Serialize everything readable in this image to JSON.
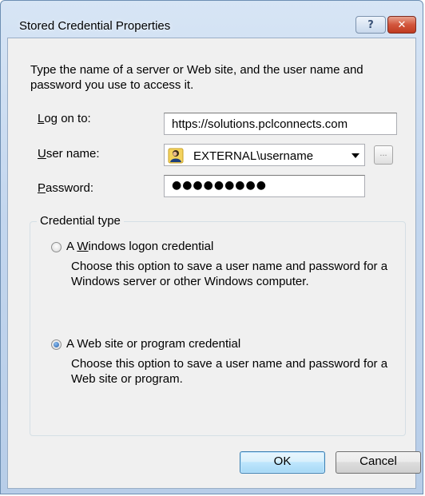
{
  "window": {
    "title": "Stored Credential Properties",
    "help_label": "?",
    "close_label": "✕"
  },
  "intro": "Type the name of a server or Web site, and the user name and password you use to access it.",
  "logon": {
    "label_prefix": "",
    "label_accel": "L",
    "label_rest": "og on to:",
    "value": "https://solutions.pclconnects.com"
  },
  "user": {
    "label_accel": "U",
    "label_rest": "ser name:",
    "value": "EXTERNAL\\username",
    "icon": "user-icon",
    "browse_label": "..."
  },
  "password": {
    "label_accel": "P",
    "label_rest": "assword:",
    "value": "●●●●●●●●●"
  },
  "credential_type": {
    "legend": "Credential type",
    "options": [
      {
        "label_prefix": "A ",
        "label_accel": "W",
        "label_rest": "indows logon credential",
        "description": "Choose this option to save a user name and password for a Windows server or other Windows computer.",
        "selected": false
      },
      {
        "label": "A Web site or program credential",
        "description": "Choose this option to save a user name and password for a Web site or program.",
        "selected": true
      }
    ]
  },
  "buttons": {
    "ok": "OK",
    "cancel": "Cancel"
  }
}
